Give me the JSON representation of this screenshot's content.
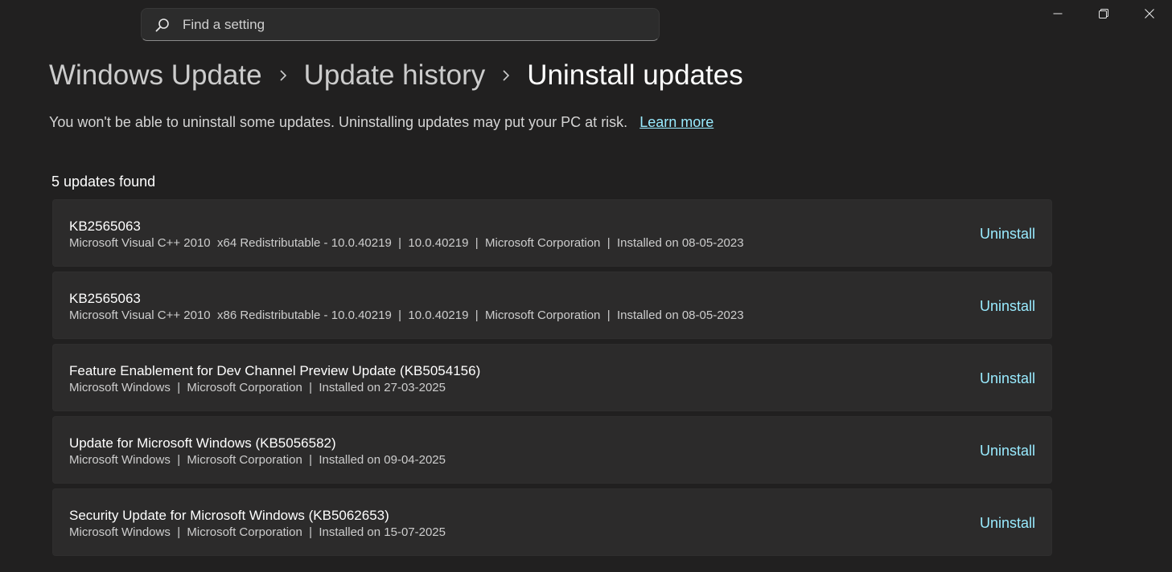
{
  "search": {
    "placeholder": "Find a setting",
    "icon": "search-icon"
  },
  "window_controls": {
    "minimize_icon": "minimize-icon",
    "restore_icon": "restore-icon",
    "close_icon": "close-icon"
  },
  "breadcrumb": {
    "items": [
      "Windows Update",
      "Update history",
      "Uninstall updates"
    ],
    "separator_icon": "chevron-right-icon"
  },
  "notice": {
    "text": "You won't be able to uninstall some updates. Uninstalling updates may put your PC at risk.",
    "link": "Learn more"
  },
  "updates": {
    "count_label": "5 updates found",
    "items": [
      {
        "title": "KB2565063",
        "details": "Microsoft Visual C++ 2010  x64 Redistributable - 10.0.40219  |  10.0.40219  |  Microsoft Corporation  |  Installed on 08-05-2023",
        "action": "Uninstall"
      },
      {
        "title": "KB2565063",
        "details": "Microsoft Visual C++ 2010  x86 Redistributable - 10.0.40219  |  10.0.40219  |  Microsoft Corporation  |  Installed on 08-05-2023",
        "action": "Uninstall"
      },
      {
        "title": "Feature Enablement for Dev Channel Preview Update (KB5054156)",
        "details": "Microsoft Windows  |  Microsoft Corporation  |  Installed on 27-03-2025",
        "action": "Uninstall"
      },
      {
        "title": "Update for Microsoft Windows (KB5056582)",
        "details": "Microsoft Windows  |  Microsoft Corporation  |  Installed on 09-04-2025",
        "action": "Uninstall"
      },
      {
        "title": "Security Update for Microsoft Windows (KB5062653)",
        "details": "Microsoft Windows  |  Microsoft Corporation  |  Installed on 15-07-2025",
        "action": "Uninstall"
      }
    ]
  },
  "colors": {
    "background": "#212020",
    "card": "#2c2b2b",
    "accent": "#99ebff",
    "text_primary": "#ffffff",
    "text_secondary": "#cdcdcd"
  }
}
